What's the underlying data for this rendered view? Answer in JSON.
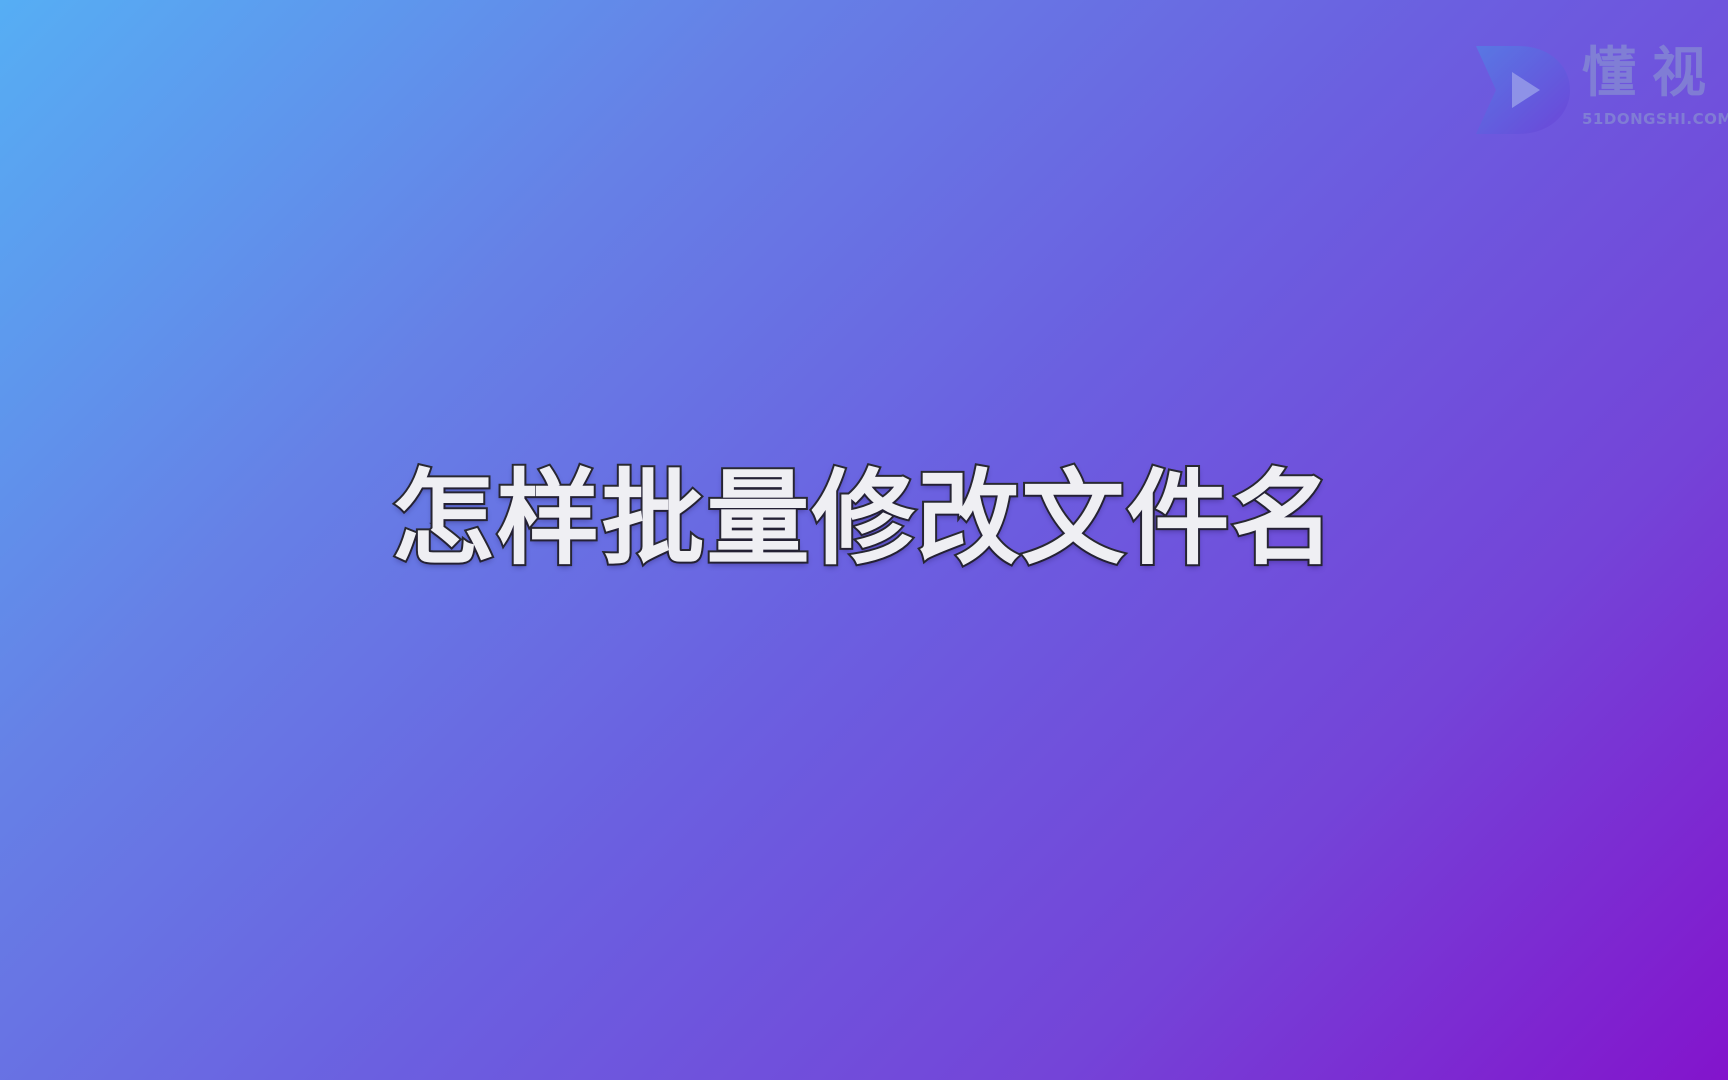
{
  "slide": {
    "title": "怎样批量修改文件名"
  },
  "watermark": {
    "brand_name": "懂视",
    "url": "51DONGSHI.COM",
    "icon": "play-d-logo-icon"
  },
  "colors": {
    "gradient_start": "#56aef4",
    "gradient_mid": "#6b5fe0",
    "gradient_end": "#8314cc",
    "title_fill": "#efeff3",
    "title_stroke": "#2a2a32",
    "logo_blue": "#3f7fe0",
    "logo_purple": "#6a3ad6"
  }
}
